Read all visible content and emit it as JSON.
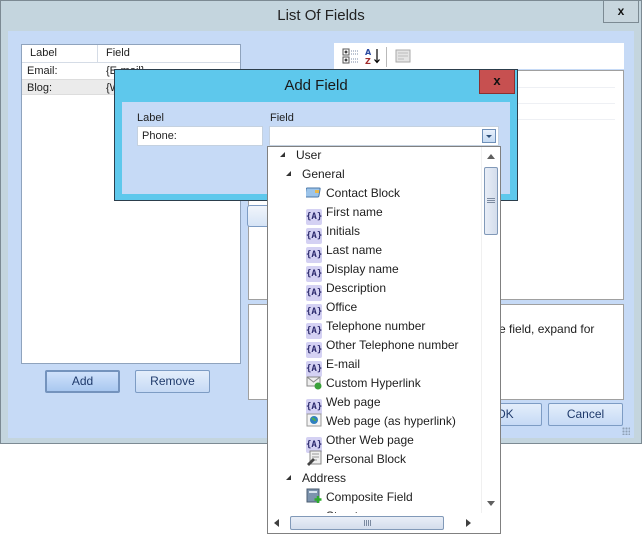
{
  "main_window": {
    "title": "List Of Fields",
    "close_label": "x",
    "list": {
      "columns": [
        "Label",
        "Field"
      ],
      "rows": [
        {
          "label": "Email:",
          "field": "{E-mail}"
        },
        {
          "label": "Blog:",
          "field": "{W"
        }
      ]
    },
    "buttons": {
      "add": "Add",
      "remove": "Remove",
      "ok": "OK",
      "cancel": "Cancel"
    },
    "property_grid": {
      "toolbar": [
        "categorized-icon",
        "sort-az-icon",
        "property-pages-icon"
      ],
      "description": "the field, expand for"
    }
  },
  "add_field_dialog": {
    "title": "Add Field",
    "close_label": "x",
    "label_caption": "Label",
    "field_caption": "Field",
    "label_value": "Phone:",
    "field_value": ""
  },
  "dropdown": {
    "items": [
      {
        "text": "User",
        "level": 0,
        "type": "group",
        "icon": "expand-icon"
      },
      {
        "text": "General",
        "level": 1,
        "type": "group",
        "icon": "expand-icon"
      },
      {
        "text": "Contact Block",
        "level": 2,
        "type": "item",
        "icon": "contact-card-icon"
      },
      {
        "text": "First name",
        "level": 2,
        "type": "item",
        "icon": "field-icon"
      },
      {
        "text": "Initials",
        "level": 2,
        "type": "item",
        "icon": "field-icon"
      },
      {
        "text": "Last name",
        "level": 2,
        "type": "item",
        "icon": "field-icon"
      },
      {
        "text": "Display name",
        "level": 2,
        "type": "item",
        "icon": "field-icon"
      },
      {
        "text": "Description",
        "level": 2,
        "type": "item",
        "icon": "field-icon"
      },
      {
        "text": "Office",
        "level": 2,
        "type": "item",
        "icon": "field-icon"
      },
      {
        "text": "Telephone number",
        "level": 2,
        "type": "item",
        "icon": "field-icon"
      },
      {
        "text": "Other Telephone number",
        "level": 2,
        "type": "item",
        "icon": "field-icon"
      },
      {
        "text": "E-mail",
        "level": 2,
        "type": "item",
        "icon": "field-icon"
      },
      {
        "text": "Custom Hyperlink",
        "level": 2,
        "type": "item",
        "icon": "envelope-link-icon"
      },
      {
        "text": "Web page",
        "level": 2,
        "type": "item",
        "icon": "field-icon"
      },
      {
        "text": "Web page (as hyperlink)",
        "level": 2,
        "type": "item",
        "icon": "globe-icon"
      },
      {
        "text": "Other Web page",
        "level": 2,
        "type": "item",
        "icon": "field-icon"
      },
      {
        "text": "Personal Block",
        "level": 2,
        "type": "item",
        "icon": "personal-block-icon"
      },
      {
        "text": "Address",
        "level": 1,
        "type": "group",
        "icon": "expand-icon"
      },
      {
        "text": "Composite Field",
        "level": 2,
        "type": "item",
        "icon": "composite-field-icon"
      },
      {
        "text": "Street",
        "level": 2,
        "type": "item",
        "icon": "field-icon"
      }
    ],
    "field_icon_glyph": "{A}"
  }
}
